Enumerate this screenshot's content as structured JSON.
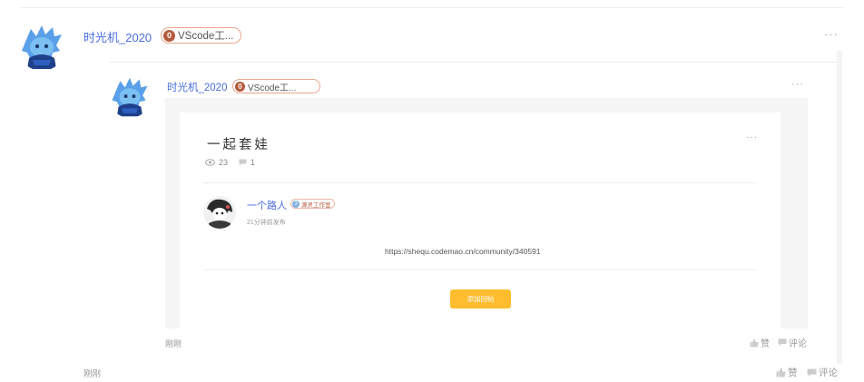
{
  "outer_comment": {
    "username": "时光机_2020",
    "badge_icon": "0",
    "badge_text": "VScode工...",
    "more": "···",
    "time": "刚刚",
    "like_label": "赞",
    "comment_label": "评论"
  },
  "reply": {
    "username": "时光机_2020",
    "badge_icon": "0",
    "badge_text": "VScode工...",
    "more": "···",
    "time": "刚刚",
    "like_label": "赞",
    "comment_label": "评论"
  },
  "embedded_post": {
    "title": "一起套娃",
    "more": "···",
    "views": "23",
    "comments": "1",
    "author": "一个路人",
    "author_badge_icon": "3",
    "author_badge": "源灵工作室",
    "publish_time": "21分钟前发布",
    "link": "https://shequ.codemao.cn/community/340591",
    "button_label": "添加回帖"
  },
  "colors": {
    "username": "#4a6ee0",
    "badge_border": "#e9a48f",
    "button": "#fdbd2f",
    "muted": "#999999"
  }
}
